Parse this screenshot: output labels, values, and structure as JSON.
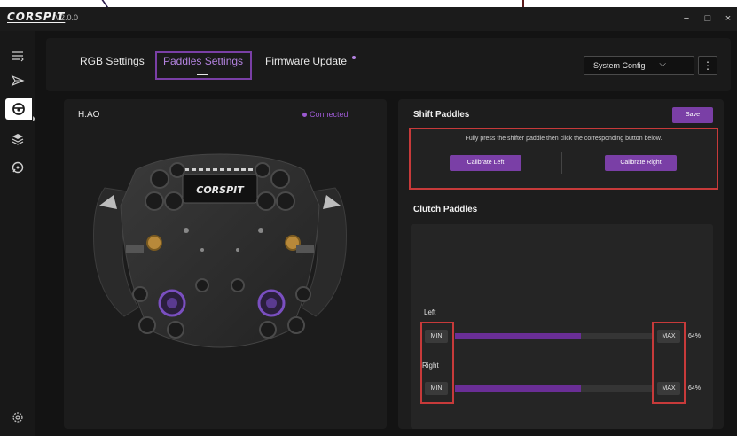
{
  "app": {
    "logo": "CORSPIT",
    "version": "V2.0.0",
    "window_controls": {
      "minimize": "−",
      "maximize": "□",
      "close": "×"
    }
  },
  "rail": {
    "items": [
      "menu-icon",
      "send-icon",
      "steering-wheel-icon",
      "layers-icon",
      "chat-icon"
    ],
    "settings_icon": "gear-icon"
  },
  "tabs": [
    {
      "label": "RGB Settings"
    },
    {
      "label": "Paddles Settings",
      "active": true
    },
    {
      "label": "Firmware Update",
      "badge_dot": true
    }
  ],
  "config_select": {
    "value": "System Config"
  },
  "device": {
    "name": "H.AO",
    "status": "Connected",
    "status_color": "#9b59d0",
    "wheel_brand": "CORSPIT"
  },
  "shift": {
    "title": "Shift Paddles",
    "save_label": "Save",
    "instruction": "Fully press the shifter paddle then click the corresponding button below.",
    "calibrate_left": "Calibrate Left",
    "calibrate_right": "Calibrate Right"
  },
  "clutch": {
    "title": "Clutch Paddles",
    "left": {
      "label": "Left",
      "min": "MIN",
      "max": "MAX",
      "percent_text": "64%",
      "level": 0.64
    },
    "right": {
      "label": "Right",
      "min": "MIN",
      "max": "MAX",
      "percent_text": "64%",
      "level": 0.64
    }
  },
  "colors": {
    "accent": "#7a3fa6",
    "highlight_box": "#c73a3a",
    "active_tab_box": "#7a3fa6"
  }
}
